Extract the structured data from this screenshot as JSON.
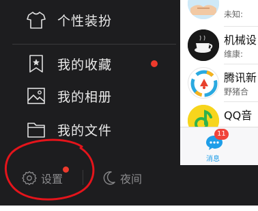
{
  "menu": {
    "items": [
      {
        "label": "个性装扮",
        "icon": "tshirt-icon"
      },
      {
        "label": "我的收藏",
        "icon": "bookmark-star-icon",
        "has_dot": true
      },
      {
        "label": "我的相册",
        "icon": "photo-icon"
      },
      {
        "label": "我的文件",
        "icon": "folder-icon"
      }
    ]
  },
  "bottom": {
    "settings_label": "设置",
    "night_label": "夜间"
  },
  "chats": [
    {
      "name": "",
      "message": "未知:"
    },
    {
      "name": "机械设",
      "message": "维康:"
    },
    {
      "name": "腾讯新",
      "message": "野猪合"
    },
    {
      "name": "QQ音",
      "message": ""
    }
  ],
  "tabbar": {
    "tab_label": "消息",
    "badge": "11"
  },
  "colors": {
    "drawer_bg": "#1d1d1f",
    "accent_blue": "#1f9ee8",
    "badge_red": "#f0443a",
    "annotation_red": "#e4141b"
  }
}
